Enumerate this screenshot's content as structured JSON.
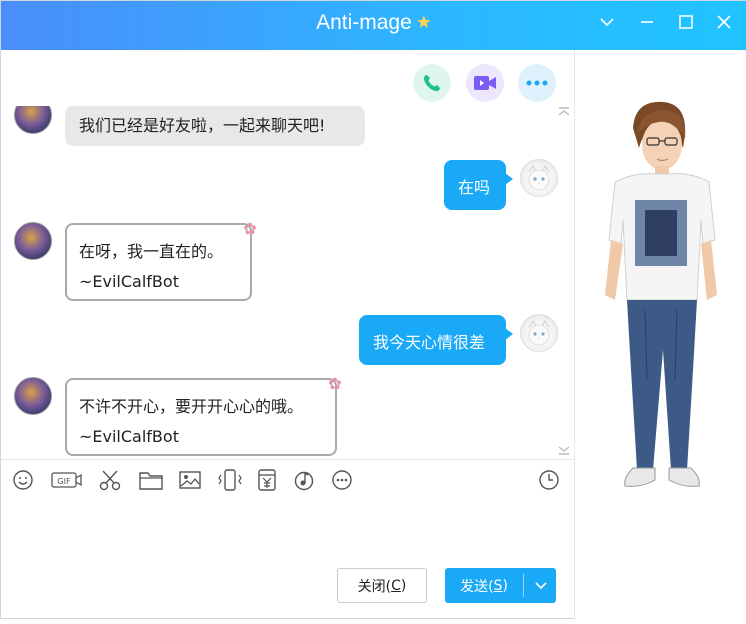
{
  "window": {
    "title": "Anti-mage",
    "vip_badge": "Z"
  },
  "controls": {
    "minimize": "—",
    "maximize": "☐",
    "close": "✕",
    "collapse": "⌄"
  },
  "header_actions": [
    {
      "name": "voice-call-button",
      "icon": "phone-icon",
      "color": "#1fbf8f"
    },
    {
      "name": "video-call-button",
      "icon": "video-icon",
      "color": "#7b5cf5"
    },
    {
      "name": "more-button",
      "icon": "more-icon",
      "color": "#1aa9f6"
    }
  ],
  "messages": {
    "m1": "我们已经是好友啦，一起来聊天吧!",
    "m2": "在吗",
    "m3_line1": "在呀，我一直在的。",
    "m3_line2": "~EvilCalfBot",
    "m4": "我今天心情很差",
    "m5_line1": "不许不开心，要开开心心的哦。",
    "m5_line2": "~EvilCalfBot"
  },
  "toolbar_icons": [
    "emoji-icon",
    "gif-icon",
    "screenshot-icon",
    "folder-icon",
    "image-icon",
    "shake-icon",
    "red-packet-icon",
    "music-icon",
    "more-tools-icon",
    "history-icon"
  ],
  "gif_label": "GIF",
  "buttons": {
    "close_label": "关闭(",
    "close_key": "C",
    "close_tail": ")",
    "send_label": "发送(",
    "send_key": "S",
    "send_tail": ")"
  },
  "colors": {
    "accent": "#1aa9f6",
    "title_start": "#4a8dfb",
    "title_end": "#1fc3ff"
  }
}
